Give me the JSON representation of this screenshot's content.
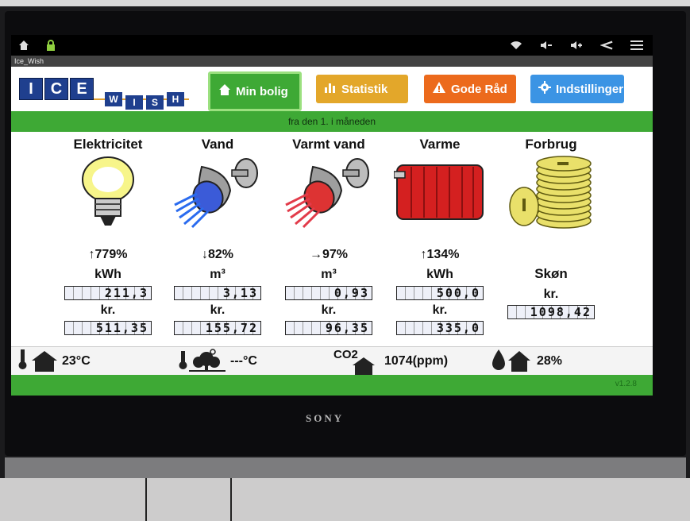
{
  "app": {
    "window_title": "Ice_Wish",
    "version": "v1.2.8",
    "subtitle": "fra den 1. i måneden"
  },
  "logo": {
    "letters_big": [
      "I",
      "C",
      "E"
    ],
    "letters_small": [
      "W",
      "I",
      "S",
      "H"
    ]
  },
  "tabs": [
    {
      "label": "Min bolig",
      "icon": "home-icon",
      "color": "#3ea935",
      "active": true
    },
    {
      "label": "Statistik",
      "icon": "bar-chart-icon",
      "color": "#e3a72a",
      "active": false
    },
    {
      "label": "Gode Råd",
      "icon": "warning-icon",
      "color": "#ec6a1c",
      "active": false
    },
    {
      "label": "Indstillinger",
      "icon": "gear-icon",
      "color": "#3b94e4",
      "active": false
    }
  ],
  "meters": [
    {
      "title": "Elektricitet",
      "icon": "lightbulb-icon",
      "trend": "↑779%",
      "unit": "kWh",
      "amount": "211,3",
      "currency": "kr.",
      "cost": "511,35"
    },
    {
      "title": "Vand",
      "icon": "cold-shower-icon",
      "trend": "↓82%",
      "unit": "m³",
      "amount": "3,13",
      "currency": "kr.",
      "cost": "155,72"
    },
    {
      "title": "Varmt vand",
      "icon": "hot-shower-icon",
      "trend": "→97%",
      "unit": "m³",
      "amount": "0,93",
      "currency": "kr.",
      "cost": "96,35"
    },
    {
      "title": "Varme",
      "icon": "radiator-icon",
      "trend": "↑134%",
      "unit": "kWh",
      "amount": "500,0",
      "currency": "kr.",
      "cost": "335,0"
    },
    {
      "title": "Forbrug",
      "icon": "coins-icon",
      "estimate": "Skøn",
      "currency": "kr.",
      "cost": "1098,42"
    }
  ],
  "footer": {
    "indoor_temp": "23°C",
    "outdoor_temp": "---°C",
    "co2_label": "CO2",
    "co2": "1074(ppm)",
    "humidity": "28%"
  },
  "colors": {
    "green": "#3ea935",
    "logo_blue": "#1f3f8e"
  },
  "tv_brand": "SONY"
}
